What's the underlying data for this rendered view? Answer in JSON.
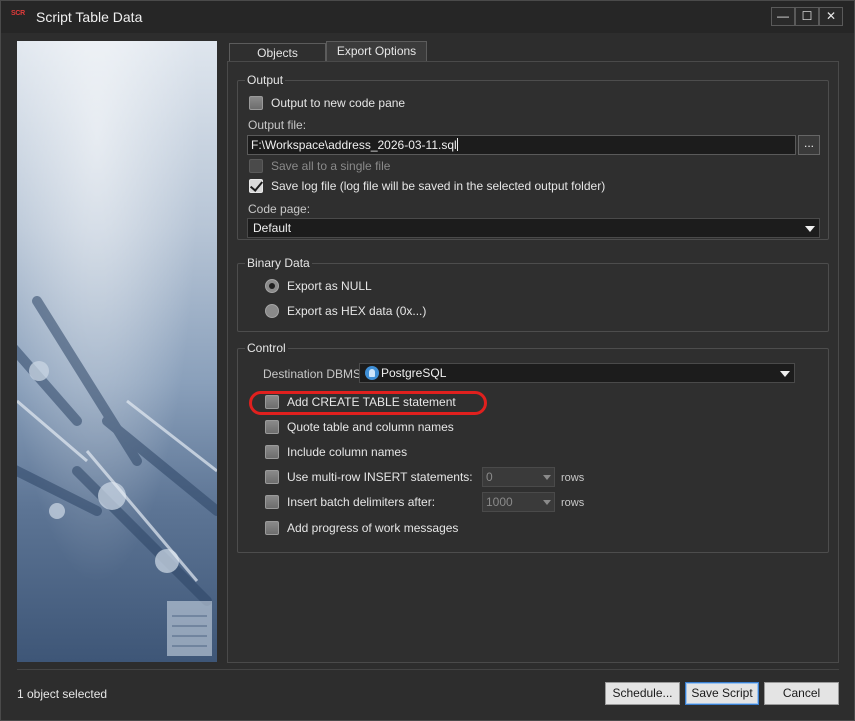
{
  "window": {
    "title": "Script Table Data",
    "app_icon_text": "SCR",
    "controls": {
      "minimize": "—",
      "maximize": "☐",
      "close": "✕"
    }
  },
  "tabs": [
    {
      "label": "Objects",
      "active": false
    },
    {
      "label": "Export Options",
      "active": true
    }
  ],
  "output": {
    "title": "Output",
    "new_code_pane_label": "Output to new code pane",
    "new_code_pane_checked": false,
    "output_file_label": "Output file:",
    "output_file_value": "F:\\Workspace\\address_2026-03-11.sql",
    "browse_label": "...",
    "save_single_file_label": "Save all to a single file",
    "save_single_file_enabled": false,
    "save_log_label": "Save log file  (log file will be saved in the selected output folder)",
    "save_log_checked": true,
    "code_page_label": "Code page:",
    "code_page_value": "Default"
  },
  "binary": {
    "title": "Binary Data",
    "export_null_label": "Export as NULL",
    "export_hex_label": "Export as HEX data  (0x...)",
    "selected": "null"
  },
  "control": {
    "title": "Control",
    "dest_dbms_label": "Destination DBMS:",
    "dest_dbms_value": "PostgreSQL",
    "dest_dbms_icon": "postgresql-elephant-icon",
    "add_create_table_label": "Add CREATE TABLE statement",
    "quote_names_label": "Quote table and column names",
    "include_columns_label": "Include column names",
    "multirow_label": "Use multi-row INSERT statements:",
    "multirow_value": "0",
    "multirow_unit": "rows",
    "batch_label": "Insert batch delimiters after:",
    "batch_value": "1000",
    "batch_unit": "rows",
    "progress_label": "Add progress of work messages"
  },
  "status": {
    "text": "1 object selected"
  },
  "buttons": {
    "schedule": "Schedule...",
    "save_script": "Save Script",
    "cancel": "Cancel"
  },
  "colors": {
    "highlight_ring": "#e0201e",
    "background": "#2d2d2d",
    "accent_blue": "#3a7fd0"
  }
}
